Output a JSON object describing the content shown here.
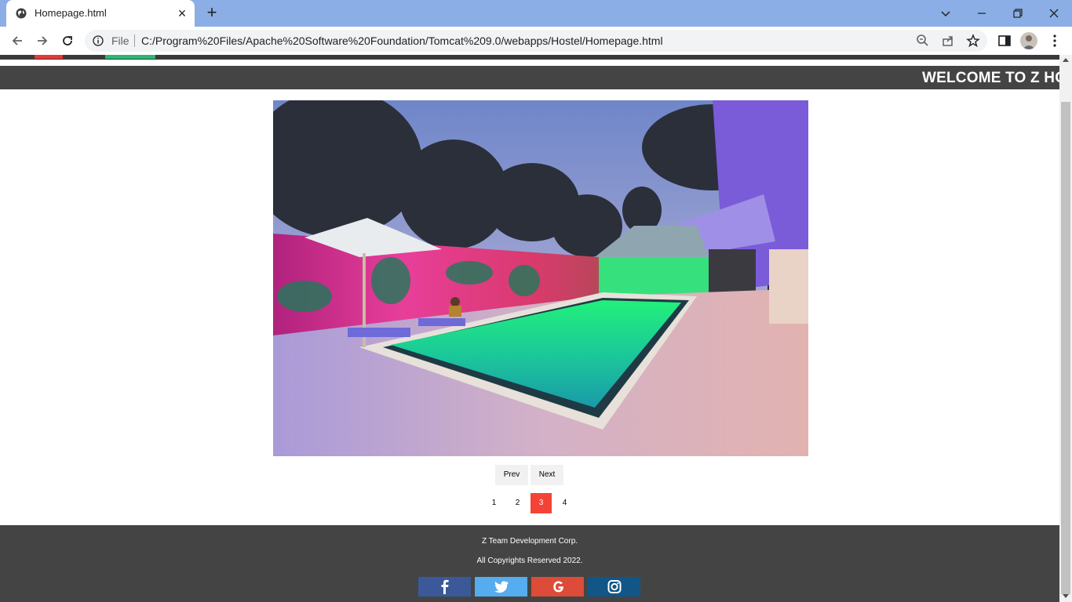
{
  "browser": {
    "tab_title": "Homepage.html",
    "omnibox_scheme": "File",
    "url": "C:/Program%20Files/Apache%20Software%20Foundation/Tomcat%209.0/webapps/Hostel/Homepage.html"
  },
  "banner": {
    "text": "WELCOME TO Z HO"
  },
  "slideshow": {
    "image_description": "pool",
    "prev_label": "Prev",
    "next_label": "Next",
    "pages": [
      "1",
      "2",
      "3",
      "4"
    ],
    "active_page": "3"
  },
  "footer": {
    "company": "Z Team Development Corp.",
    "copyright": "All Copyrights Reserved 2022.",
    "social": [
      {
        "name": "facebook",
        "color": "#3b5998"
      },
      {
        "name": "twitter",
        "color": "#55acee"
      },
      {
        "name": "google",
        "color": "#dd4b39"
      },
      {
        "name": "instagram",
        "color": "#125688"
      }
    ]
  },
  "colors": {
    "banner_bg": "#444444",
    "active_dot": "#f44336",
    "tab_strip": "#8aaee5"
  }
}
